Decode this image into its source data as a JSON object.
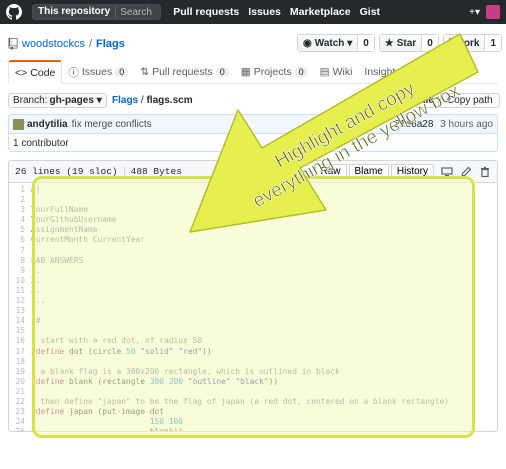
{
  "header": {
    "scope_label": "This repository",
    "search_placeholder": "Search",
    "nav": [
      "Pull requests",
      "Issues",
      "Marketplace",
      "Gist"
    ],
    "plus_label": "+▾"
  },
  "repo": {
    "owner": "woodstockcs",
    "separator": "/",
    "name": "Flags",
    "watch_label": "Watch ▾",
    "watch_count": "0",
    "star_label": "Star",
    "star_count": "0",
    "fork_label": "Fork",
    "fork_count": "1"
  },
  "tabs": [
    {
      "label": "Code",
      "count": ""
    },
    {
      "label": "Issues",
      "count": "0"
    },
    {
      "label": "Pull requests",
      "count": "0"
    },
    {
      "label": "Projects",
      "count": "0"
    },
    {
      "label": "Wiki",
      "count": ""
    },
    {
      "label": "Insights ▾",
      "count": ""
    }
  ],
  "file_nav": {
    "branch_prefix": "Branch:",
    "branch": "gh-pages ▾",
    "path_root": "Flags",
    "path_sep": " / ",
    "path_file": "flags.scm",
    "find_file_label": "File",
    "copy_path_label": "Copy path"
  },
  "commit": {
    "author": "andytilia",
    "message": "fix merge conflicts",
    "sha": "21e6a28",
    "time": "3 hours ago",
    "contributors": "1 contributor"
  },
  "file": {
    "lines_info": "26 lines (19 sloc)",
    "size": "488 Bytes",
    "raw_label": "Raw",
    "blame_label": "Blame",
    "history_label": "History"
  },
  "code_lines": [
    {
      "n": "1",
      "t": "#|",
      "c": "cm"
    },
    {
      "n": "2",
      "t": "",
      "c": "cm"
    },
    {
      "n": "3",
      "t": "YourFullName",
      "c": "cm"
    },
    {
      "n": "4",
      "t": "YourGithubUsername",
      "c": "cm"
    },
    {
      "n": "5",
      "t": "AssignmentName",
      "c": "cm"
    },
    {
      "n": "6",
      "t": "CurrentMonth CurrentYear",
      "c": "cm"
    },
    {
      "n": "7",
      "t": "",
      "c": "cm"
    },
    {
      "n": "8",
      "t": "LAB ANSWERS",
      "c": "cm"
    },
    {
      "n": "9",
      "t": "1.",
      "c": "cm"
    },
    {
      "n": "10",
      "t": "2.",
      "c": "cm"
    },
    {
      "n": "11",
      "t": "3.",
      "c": "cm"
    },
    {
      "n": "12",
      "t": "...",
      "c": "cm"
    },
    {
      "n": "13",
      "t": "",
      "c": "cm"
    },
    {
      "n": "14",
      "t": "|#",
      "c": "cm"
    },
    {
      "n": "15",
      "t": "",
      "c": "lc"
    },
    {
      "n": "16",
      "t": "; start with a red dot, of radius 50",
      "c": "cm"
    },
    {
      "n": "17",
      "t": "(define dot (circle 50 \"solid\" \"red\"))",
      "c": "lc"
    },
    {
      "n": "18",
      "t": "",
      "c": "lc"
    },
    {
      "n": "19",
      "t": "; a blank flag is a 300x200 rectangle, which is outlined in black",
      "c": "cm"
    },
    {
      "n": "20",
      "t": "(define blank (rectangle 300 200 \"outline\" \"black\"))",
      "c": "lc"
    },
    {
      "n": "21",
      "t": "",
      "c": "lc"
    },
    {
      "n": "22",
      "t": "; then define \"japan\" to be the flag of japan (a red dot, centered on a blank rectangle)",
      "c": "cm"
    },
    {
      "n": "23",
      "t": "(define japan (put-image dot",
      "c": "lc"
    },
    {
      "n": "24",
      "t": "                         150 100",
      "c": "lc"
    },
    {
      "n": "25",
      "t": "                         blank))",
      "c": "lc"
    },
    {
      "n": "26",
      "t": "",
      "c": "lc"
    }
  ],
  "annotation": {
    "line1": "Highlight and copy",
    "line2": "everything in the yellow box",
    "color": "#d7e246"
  }
}
